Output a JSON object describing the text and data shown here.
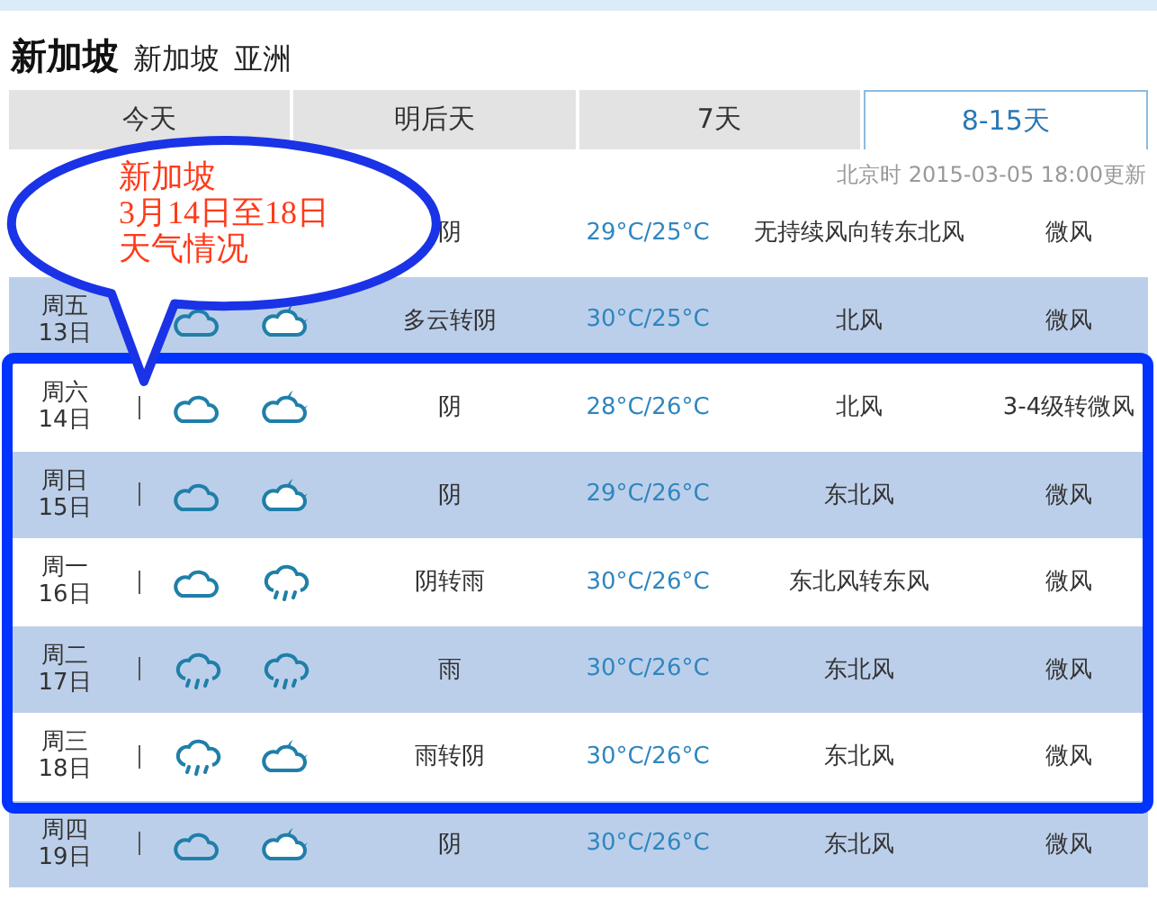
{
  "header": {
    "title": "新加坡",
    "region": "新加坡",
    "continent": "亚洲"
  },
  "tabs": [
    {
      "label": "今天",
      "selected": false
    },
    {
      "label": "明后天",
      "selected": false
    },
    {
      "label": "7天",
      "selected": false
    },
    {
      "label": "8-15天",
      "selected": true
    }
  ],
  "update_time": "北京时 2015-03-05 18:00更新",
  "rows": [
    {
      "weather": "阴",
      "temp": "29°C/25°C",
      "wind": "无持续风向转东北风",
      "force": "微风"
    },
    {
      "day": "周五",
      "date": "13日",
      "icons": [
        {
          "kind": "cloud"
        },
        {
          "kind": "cloud_moon"
        }
      ],
      "weather": "多云转阴",
      "temp": "30°C/25°C",
      "wind": "北风",
      "force": "微风"
    },
    {
      "day": "周六",
      "date": "14日",
      "icons": [
        {
          "kind": "cloud"
        },
        {
          "kind": "cloud_moon"
        }
      ],
      "weather": "阴",
      "temp": "28°C/26°C",
      "wind": "北风",
      "force": "3-4级转微风"
    },
    {
      "day": "周日",
      "date": "15日",
      "icons": [
        {
          "kind": "cloud"
        },
        {
          "kind": "cloud_moon"
        }
      ],
      "weather": "阴",
      "temp": "29°C/26°C",
      "wind": "东北风",
      "force": "微风"
    },
    {
      "day": "周一",
      "date": "16日",
      "icons": [
        {
          "kind": "cloud"
        },
        {
          "kind": "rain"
        }
      ],
      "weather": "阴转雨",
      "temp": "30°C/26°C",
      "wind": "东北风转东风",
      "force": "微风"
    },
    {
      "day": "周二",
      "date": "17日",
      "icons": [
        {
          "kind": "rain"
        },
        {
          "kind": "rain"
        }
      ],
      "weather": "雨",
      "temp": "30°C/26°C",
      "wind": "东北风",
      "force": "微风"
    },
    {
      "day": "周三",
      "date": "18日",
      "icons": [
        {
          "kind": "rain"
        },
        {
          "kind": "cloud_moon"
        }
      ],
      "weather": "雨转阴",
      "temp": "30°C/26°C",
      "wind": "东北风",
      "force": "微风"
    },
    {
      "day": "周四",
      "date": "19日",
      "icons": [
        {
          "kind": "cloud"
        },
        {
          "kind": "cloud_moon"
        }
      ],
      "weather": "阴",
      "temp": "30°C/26°C",
      "wind": "东北风",
      "force": "微风"
    }
  ],
  "annotation": {
    "lines": [
      "新加坡",
      "3月14日至18日",
      "天气情况"
    ]
  }
}
